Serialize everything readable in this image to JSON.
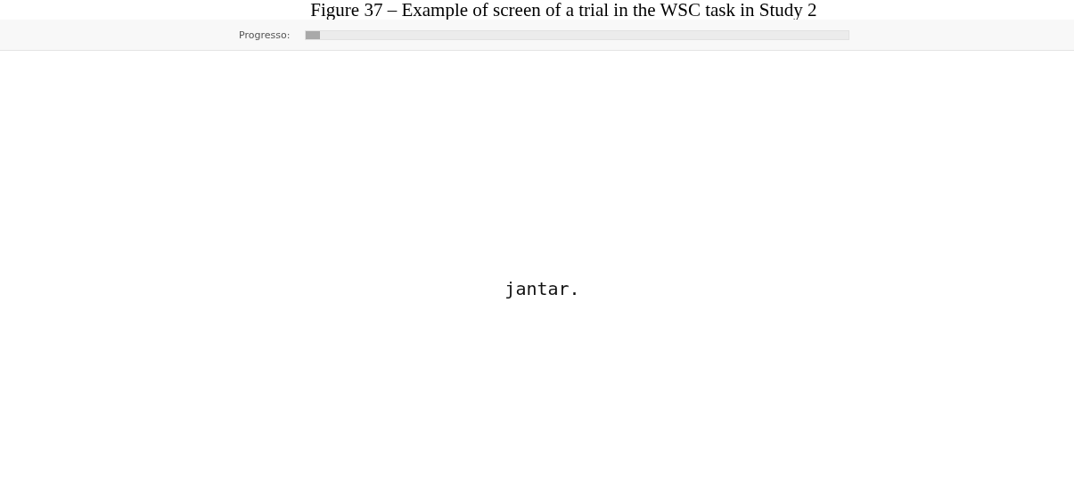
{
  "caption": "Figure 37 – Example of screen of a trial in the WSC task in Study 2",
  "progress": {
    "label": "Progresso:",
    "level": 0.026
  },
  "stimulus": "jantar."
}
